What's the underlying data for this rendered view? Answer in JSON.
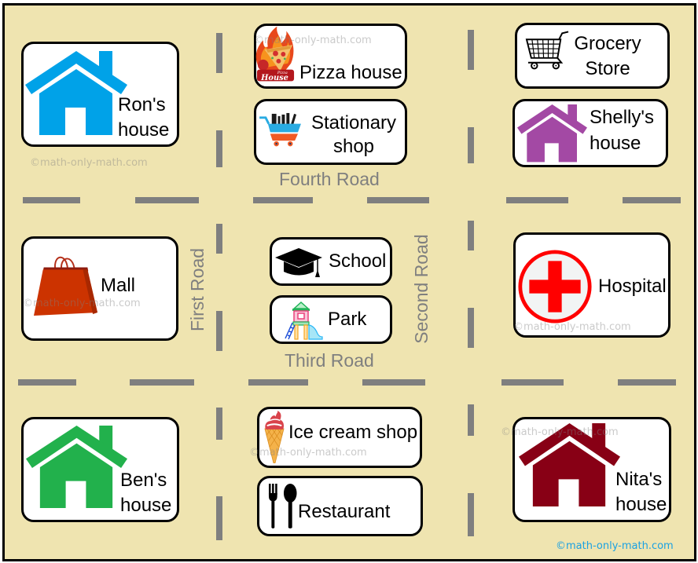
{
  "roads": {
    "fourth": "Fourth Road",
    "third": "Third Road",
    "first": "First Road",
    "second": "Second Road"
  },
  "places": {
    "rons_house": {
      "lines": [
        "Ron's",
        "house"
      ],
      "icon": "house-icon",
      "color": "#00A2E8"
    },
    "pizza_house": {
      "lines": [
        "Pizza house"
      ],
      "icon": "pizza-house-logo-icon",
      "logo_text": [
        "Pizza",
        "House"
      ]
    },
    "stationary_shop": {
      "lines": [
        "Stationary",
        "shop"
      ],
      "icon": "stationery-cart-icon"
    },
    "grocery_store": {
      "lines": [
        "Grocery",
        "Store"
      ],
      "icon": "shopping-cart-icon"
    },
    "shellys_house": {
      "lines": [
        "Shelly's",
        "house"
      ],
      "icon": "house-icon",
      "color": "#A349A4"
    },
    "mall": {
      "lines": [
        "Mall"
      ],
      "icon": "shopping-bag-icon",
      "color": "#CC3300"
    },
    "school": {
      "lines": [
        "School"
      ],
      "icon": "graduation-cap-icon"
    },
    "park": {
      "lines": [
        "Park"
      ],
      "icon": "playground-slide-icon"
    },
    "hospital": {
      "lines": [
        "Hospital"
      ],
      "icon": "medical-cross-icon",
      "color": "#FF0000"
    },
    "bens_house": {
      "lines": [
        "Ben's",
        "house"
      ],
      "icon": "house-icon",
      "color": "#22B14C"
    },
    "ice_cream_shop": {
      "lines": [
        "Ice cream shop"
      ],
      "icon": "ice-cream-cone-icon"
    },
    "restaurant": {
      "lines": [
        "Restaurant"
      ],
      "icon": "fork-and-spoon-icon"
    },
    "nitas_house": {
      "lines": [
        "Nita's",
        "house"
      ],
      "icon": "house-icon",
      "color": "#880015"
    }
  },
  "watermark": {
    "text": "©math-only-math.com",
    "credit_text": "©math-only-math.com",
    "credit_color": "#1BA1E2"
  },
  "colors": {
    "ground": "#EFE4B0",
    "road_marking": "#7F7F7F",
    "road_label": "#7F7F7F"
  }
}
